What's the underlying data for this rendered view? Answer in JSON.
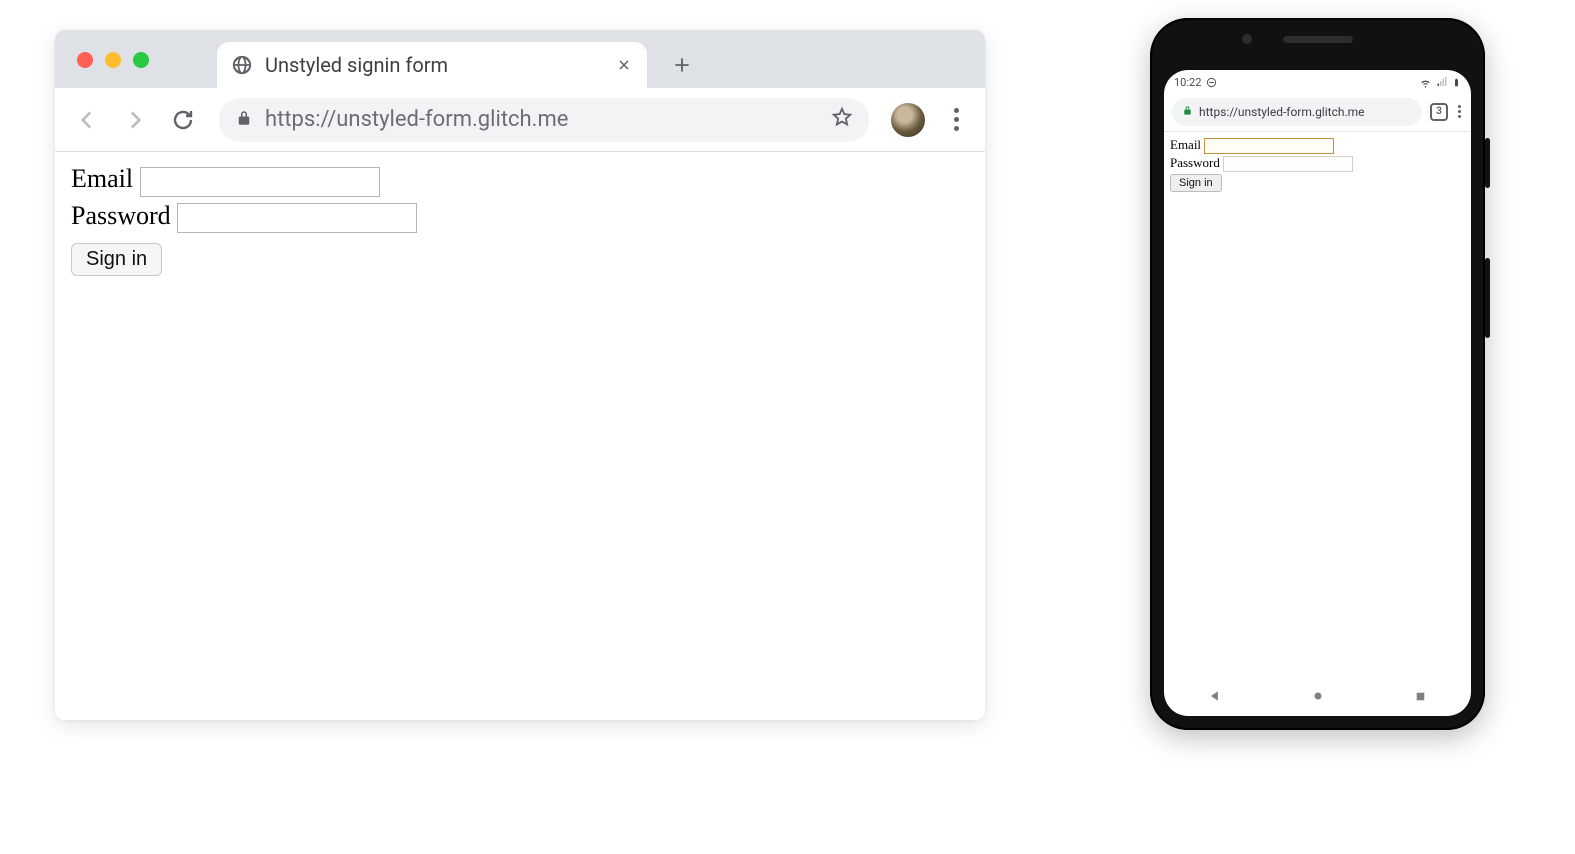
{
  "desktop": {
    "tab_title": "Unstyled signin form",
    "url": "https://unstyled-form.glitch.me",
    "form": {
      "email_label": "Email",
      "password_label": "Password",
      "submit_label": "Sign in"
    }
  },
  "mobile": {
    "status_time": "10:22",
    "url": "https://unstyled-form.glitch.me",
    "tab_count": "3",
    "form": {
      "email_label": "Email",
      "password_label": "Password",
      "submit_label": "Sign in"
    }
  }
}
